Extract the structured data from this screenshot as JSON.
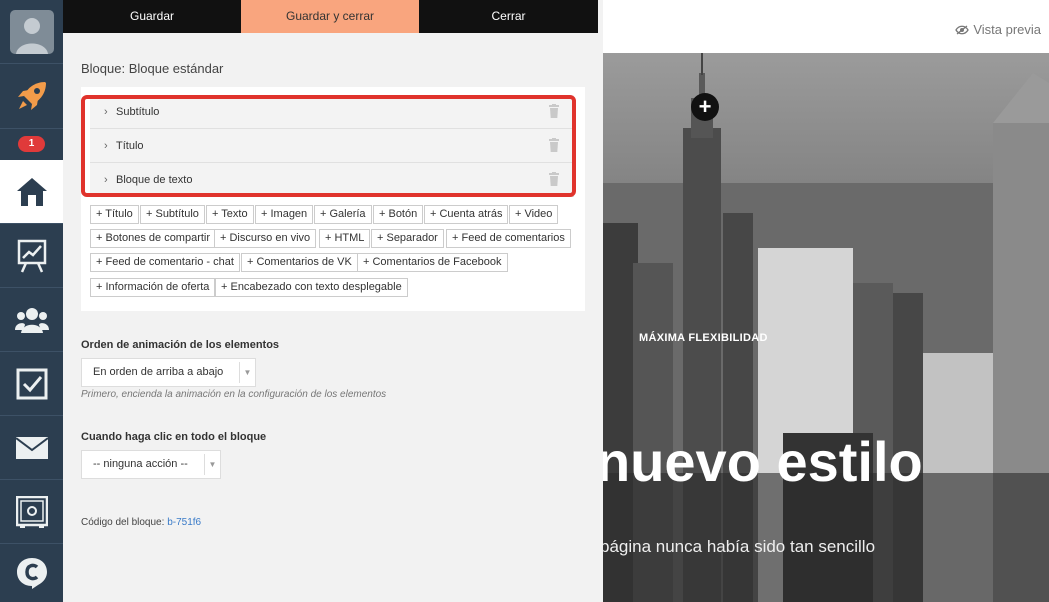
{
  "sidebar": {
    "notification_count": "1",
    "items": [
      {
        "icon": "user-avatar-icon"
      },
      {
        "icon": "rocket-icon"
      },
      {
        "icon": "home-icon"
      },
      {
        "icon": "chart-board-icon"
      },
      {
        "icon": "users-icon"
      },
      {
        "icon": "checkbox-icon"
      },
      {
        "icon": "mail-icon"
      },
      {
        "icon": "safe-icon"
      },
      {
        "icon": "chat-logo-icon"
      }
    ]
  },
  "toolbar": {
    "save_label": "Guardar",
    "save_close_label": "Guardar y cerrar",
    "close_label": "Cerrar"
  },
  "block": {
    "title": "Bloque: Bloque estándar",
    "elements": [
      {
        "label": "Subtítulo"
      },
      {
        "label": "Título"
      },
      {
        "label": "Bloque de texto"
      }
    ],
    "add_buttons": [
      "+ Título",
      "+ Subtítulo",
      "+ Texto",
      "+ Imagen",
      "+ Galería",
      "+ Botón",
      "+ Cuenta atrás",
      "+ Video",
      "+ Botones de compartir",
      "+ Discurso en vivo",
      "+ HTML",
      "+ Separador",
      "+ Feed de comentarios",
      "+ Feed de comentario - chat",
      "+ Comentarios de VK",
      "+ Comentarios de Facebook",
      "+ Información de oferta",
      "+ Encabezado con texto desplegable"
    ],
    "animation_label": "Orden de animación de los elementos",
    "animation_value": "En orden de arriba a abajo",
    "animation_hint": "Primero, encienda la animación en la configuración de los elementos",
    "click_label": "Cuando haga clic en todo el bloque",
    "click_value": "-- ninguna acción --",
    "code_label": "Código del bloque:",
    "code_value": "b-751f6"
  },
  "preview": {
    "preview_label": "Vista previa",
    "kicker": "MÁXIMA FLEXIBILIDAD",
    "hero_title": "nuevo estilo",
    "hero_subtitle": "página nunca había sido tan sencillo",
    "add_icon": "plus-circle-icon"
  },
  "colors": {
    "sidebar_bg": "#2c3e50",
    "accent_tab": "#f9a57e",
    "highlight": "#e0332c",
    "badge": "#e03a3a",
    "link": "#3a7bc8"
  }
}
